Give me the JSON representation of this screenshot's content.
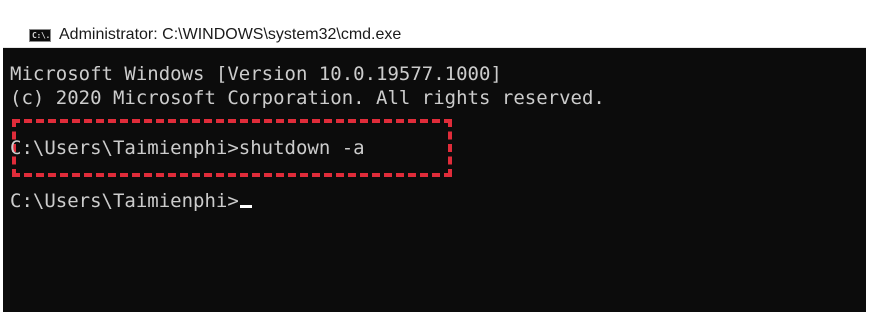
{
  "window": {
    "title": "Administrator: C:\\WINDOWS\\system32\\cmd.exe",
    "icon": "cmd-icon",
    "icon_text": "C:\\."
  },
  "console": {
    "lines": [
      "Microsoft Windows [Version 10.0.19577.1000]",
      "(c) 2020 Microsoft Corporation. All rights reserved.",
      "C:\\Users\\Taimienphi>shutdown -a",
      "C:\\Users\\Taimienphi>"
    ]
  },
  "colors": {
    "console_background": "#0c0c0c",
    "console_text": "#cccccc",
    "highlight_border": "#e02c3a"
  }
}
